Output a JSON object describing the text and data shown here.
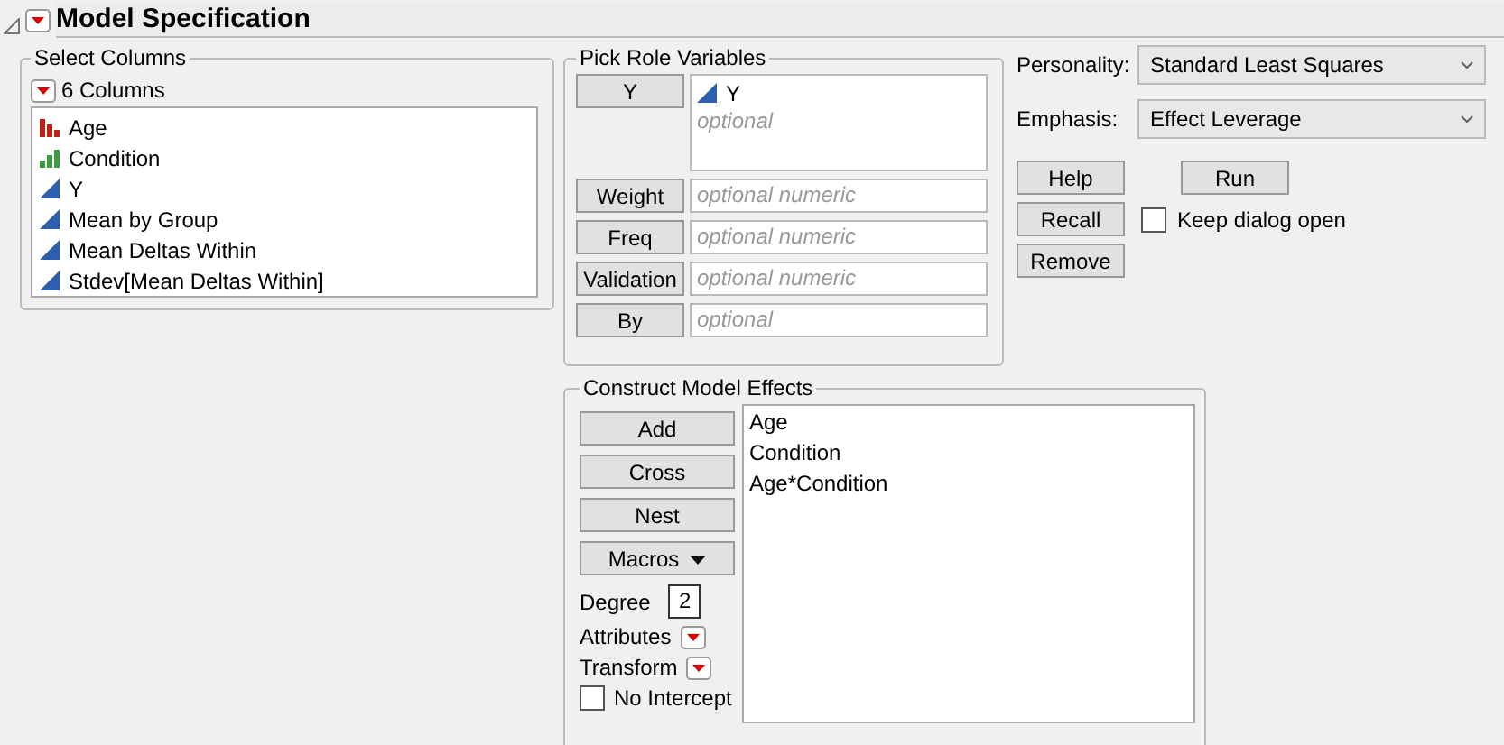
{
  "title": "Model Specification",
  "select_columns": {
    "legend": "Select Columns",
    "count_label": "6 Columns",
    "columns": [
      {
        "name": "Age",
        "kind": "nominal"
      },
      {
        "name": "Condition",
        "kind": "ordinal"
      },
      {
        "name": "Y",
        "kind": "continuous"
      },
      {
        "name": "Mean by Group",
        "kind": "continuous"
      },
      {
        "name": "Mean Deltas Within",
        "kind": "continuous"
      },
      {
        "name": "Stdev[Mean Deltas Within]",
        "kind": "continuous"
      }
    ]
  },
  "pick_roles": {
    "legend": "Pick Role Variables",
    "roles": [
      {
        "button": "Y",
        "kind": "list",
        "items": [
          {
            "name": "Y",
            "kind": "continuous"
          }
        ],
        "placeholder": "optional"
      },
      {
        "button": "Weight",
        "kind": "field",
        "placeholder": "optional numeric"
      },
      {
        "button": "Freq",
        "kind": "field",
        "placeholder": "optional numeric"
      },
      {
        "button": "Validation",
        "kind": "field",
        "placeholder": "optional numeric"
      },
      {
        "button": "By",
        "kind": "field",
        "placeholder": "optional"
      }
    ]
  },
  "settings": [
    {
      "label": "Personality:",
      "value": "Standard Least Squares"
    },
    {
      "label": "Emphasis:",
      "value": "Effect Leverage"
    }
  ],
  "actions": {
    "help": "Help",
    "run": "Run",
    "recall": "Recall",
    "remove": "Remove",
    "keep_open": {
      "label": "Keep dialog open",
      "checked": false
    }
  },
  "effects": {
    "legend": "Construct Model Effects",
    "buttons": [
      {
        "label": "Add",
        "kind": "button"
      },
      {
        "label": "Cross",
        "kind": "button"
      },
      {
        "label": "Nest",
        "kind": "button"
      },
      {
        "label": "Macros",
        "kind": "menu"
      }
    ],
    "degree_label": "Degree",
    "degree": "2",
    "menus": [
      "Attributes",
      "Transform"
    ],
    "no_intercept": {
      "label": "No Intercept",
      "checked": false
    },
    "list": [
      "Age",
      "Condition",
      "Age*Condition"
    ]
  }
}
